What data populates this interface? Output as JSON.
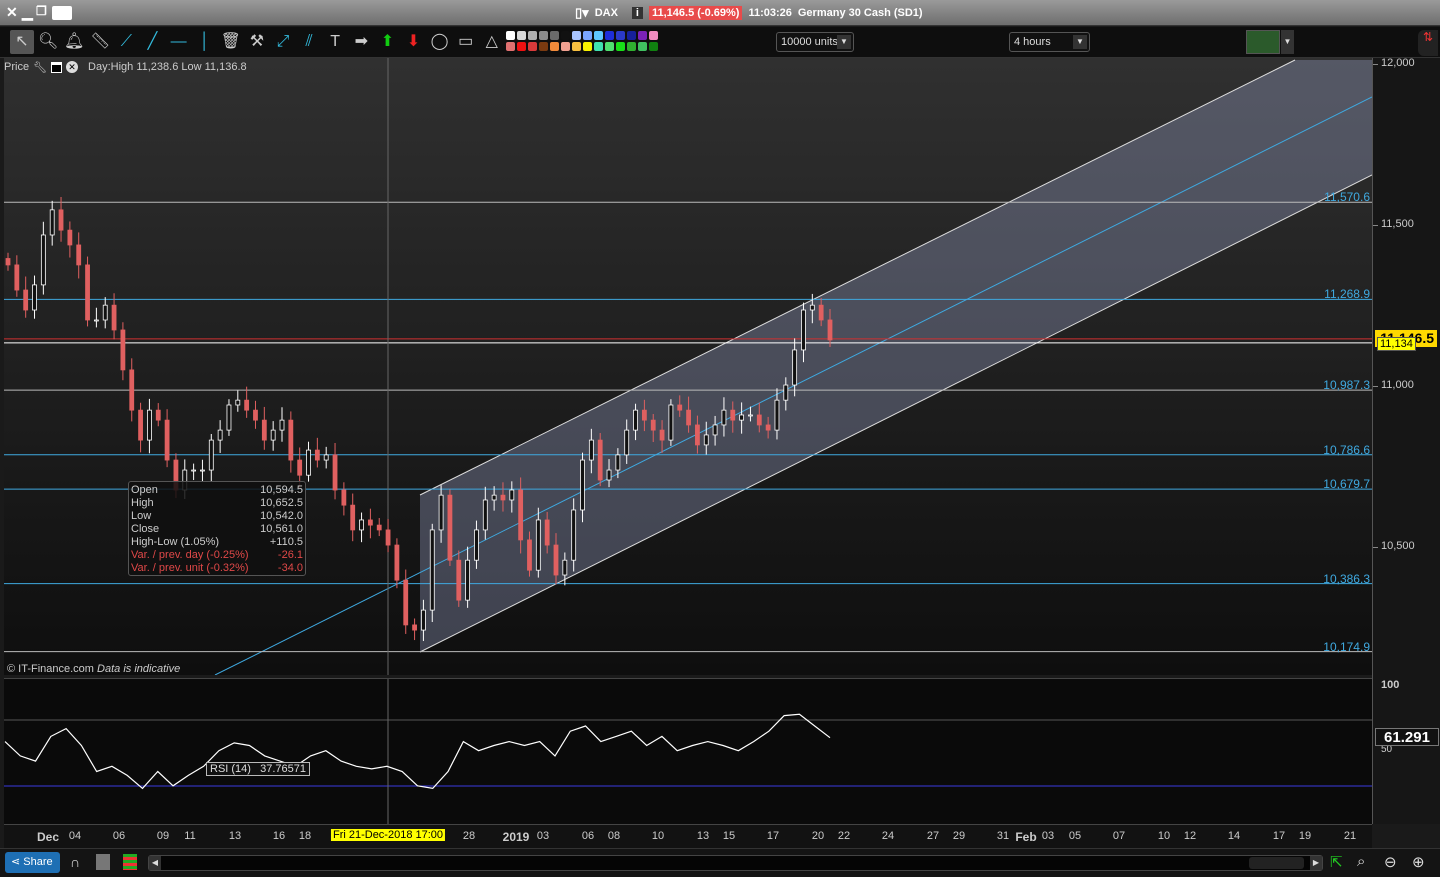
{
  "window": {
    "close": "✕",
    "minimize": "▁",
    "restore": "❐",
    "keyboard_icon": "keyboard-icon"
  },
  "title": {
    "instrument": "DAX",
    "price": "11,146.5 (-0.69%)",
    "time": "11:03:26",
    "name": "Germany 30 Cash (SD1)",
    "info": "i"
  },
  "toolbar": {
    "tools": [
      "pointer",
      "zoom",
      "alert",
      "ruler",
      "segment",
      "line",
      "horizontal-line",
      "vertical-line",
      "trash",
      "tools",
      "trend-points",
      "parallel-channel",
      "text",
      "arrow-right",
      "arrow-up",
      "arrow-down",
      "ellipse",
      "rectangle",
      "triangle"
    ],
    "palette_top": [
      "#ffffff",
      "#d8d8d8",
      "#b0b0b0",
      "#8c8c8c",
      "#6a6a6a",
      "#111111",
      "#a8c4ff",
      "#7aa6ff",
      "#5fc8ff",
      "#1e2ed8",
      "#2b3ac8",
      "#16209a",
      "#7a22b8",
      "#f08cc0"
    ],
    "palette_bottom": [
      "#e07070",
      "#ee1111",
      "#d83a3a",
      "#7a3a10",
      "#f08a3a",
      "#f0a090",
      "#f8c040",
      "#f8f000",
      "#40e0b0",
      "#50e070",
      "#18e018",
      "#30b030",
      "#40c060",
      "#108010"
    ],
    "units": "10000 units",
    "timeframe": "4 hours"
  },
  "chart": {
    "price_label": "Price",
    "day_info": "Day:High 11,238.6 Low 11,136.8",
    "copyright": "© IT-Finance.com",
    "indicative": "Data is indicative",
    "price_ticks": [
      "12,000",
      "11,500",
      "11,000",
      "10,500"
    ],
    "price_tick_values": [
      12000,
      11500,
      11000,
      10500
    ],
    "current_price": "11,146.5",
    "crosshair_price": "11,134",
    "horizontal_levels": [
      {
        "label": "11,570.6",
        "value": 11570.6,
        "color": "#bbbbbb"
      },
      {
        "label": "11,268.9",
        "value": 11268.9,
        "color": "#3fa9e0"
      },
      {
        "label": "10,987.3",
        "value": 10987.3,
        "color": "#bbbbbb"
      },
      {
        "label": "10,786.6",
        "value": 10786.6,
        "color": "#3fa9e0"
      },
      {
        "label": "10,679.7",
        "value": 10679.7,
        "color": "#3fa9e0"
      },
      {
        "label": "10,386.3",
        "value": 10386.3,
        "color": "#3fa9e0"
      },
      {
        "label": "10,174.9",
        "value": 10174.9,
        "color": "#bbbbbb"
      }
    ],
    "closes": [
      11376,
      11298,
      11236,
      11314,
      11469,
      11547,
      11484,
      11438,
      11376,
      11205,
      11205,
      11251,
      11174,
      11050,
      10925,
      10832,
      10925,
      10894,
      10770,
      10677,
      10739,
      10739,
      10739,
      10832,
      10863,
      10941,
      10956,
      10925,
      10894,
      10832,
      10863,
      10894,
      10770,
      10723,
      10801,
      10770,
      10786,
      10677,
      10630,
      10553,
      10584,
      10568,
      10553,
      10506,
      10397,
      10258,
      10242,
      10304,
      10553,
      10661,
      10459,
      10335,
      10459,
      10553,
      10646,
      10661,
      10646,
      10677,
      10522,
      10428,
      10584,
      10506,
      10413,
      10459,
      10615,
      10770,
      10832,
      10708,
      10739,
      10786,
      10863,
      10925,
      10894,
      10863,
      10832,
      10941,
      10925,
      10879,
      10817,
      10848,
      10879,
      10925,
      10894,
      10910,
      10910,
      10879,
      10863,
      10956,
      11003,
      11112,
      11236,
      11251,
      11205,
      11143
    ],
    "ohlc_tooltip": [
      {
        "k": "Open",
        "v": "10,594.5",
        "neg": false
      },
      {
        "k": "High",
        "v": "10,652.5",
        "neg": false
      },
      {
        "k": "Low",
        "v": "10,542.0",
        "neg": false
      },
      {
        "k": "Close",
        "v": "10,561.0",
        "neg": false
      },
      {
        "k": "High-Low (1.05%)",
        "v": "+110.5",
        "neg": false
      },
      {
        "k": "Var. / prev. day (-0.25%)",
        "v": "-26.1",
        "neg": true
      },
      {
        "k": "Var. / prev. unit (-0.32%)",
        "v": "-34.0",
        "neg": true
      }
    ],
    "colors": {
      "up": "#ffffff",
      "down": "#e06060",
      "channel": "#9aa4c8",
      "midline": "#3fa9e0",
      "current": "#d03030"
    }
  },
  "rsi": {
    "label": "RSI (14)",
    "value_at_cursor": "37.76571",
    "current": "61.291",
    "ticks": [
      "100",
      "50"
    ],
    "values": [
      58,
      47,
      43,
      62,
      68,
      55,
      35,
      39,
      32,
      22,
      35,
      24,
      32,
      39,
      51,
      57,
      55,
      47,
      43,
      39,
      47,
      51,
      43,
      39,
      37,
      39,
      35,
      24,
      22,
      35,
      58,
      51,
      55,
      58,
      55,
      58,
      47,
      66,
      70,
      58,
      62,
      66,
      55,
      62,
      51,
      55,
      58,
      55,
      51,
      58,
      66,
      78,
      79,
      70,
      61
    ]
  },
  "xaxis": {
    "labels": [
      {
        "t": "Dec",
        "b": true
      },
      {
        "t": "04"
      },
      {
        "t": "06"
      },
      {
        "t": "09"
      },
      {
        "t": "11"
      },
      {
        "t": "13"
      },
      {
        "t": "16"
      },
      {
        "t": "18"
      },
      {
        "t": "Fri 21-Dec-2018 17:00",
        "hl": true
      },
      {
        "t": "28"
      },
      {
        "t": "2019",
        "b": true
      },
      {
        "t": "03"
      },
      {
        "t": "06"
      },
      {
        "t": "08"
      },
      {
        "t": "10"
      },
      {
        "t": "13"
      },
      {
        "t": "15"
      },
      {
        "t": "17"
      },
      {
        "t": "20"
      },
      {
        "t": "22"
      },
      {
        "t": "24"
      },
      {
        "t": "27"
      },
      {
        "t": "29"
      },
      {
        "t": "31"
      },
      {
        "t": "Feb",
        "b": true
      },
      {
        "t": "03"
      },
      {
        "t": "05"
      },
      {
        "t": "07"
      },
      {
        "t": "10"
      },
      {
        "t": "12"
      },
      {
        "t": "14"
      },
      {
        "t": "17"
      },
      {
        "t": "19"
      },
      {
        "t": "21"
      }
    ]
  },
  "bottom": {
    "share": "Share"
  }
}
